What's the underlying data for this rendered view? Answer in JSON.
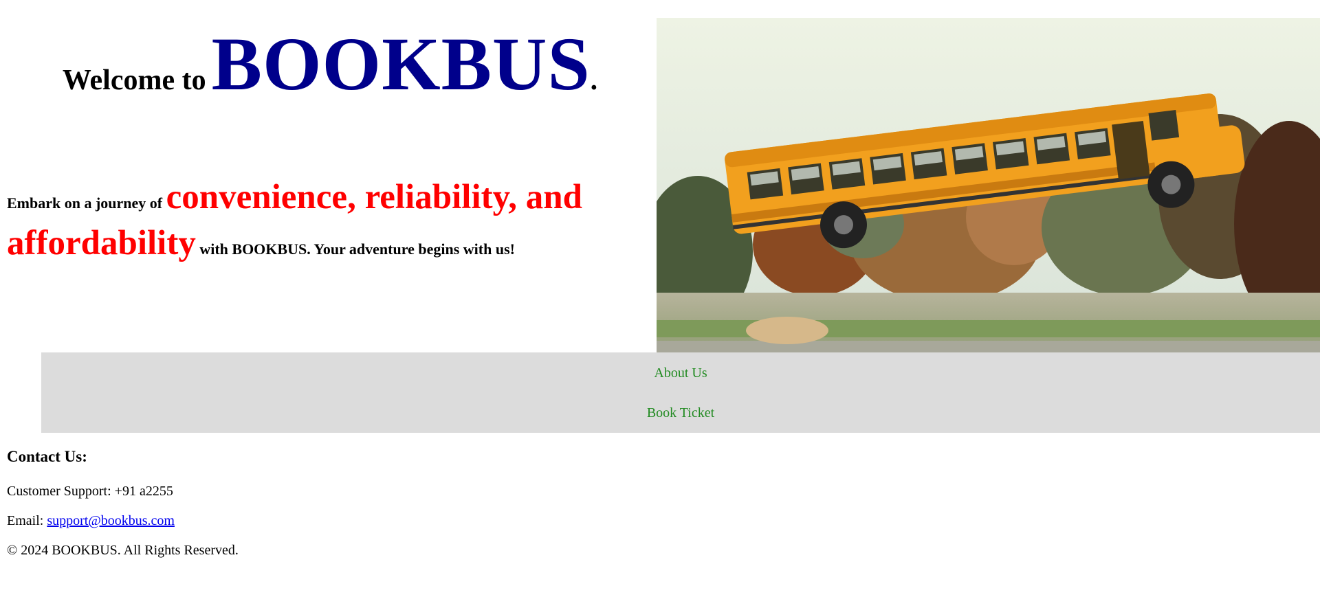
{
  "header": {
    "welcome_prefix": "Welcome to",
    "brand": "BOOKBUS",
    "brand_suffix": "."
  },
  "tagline": {
    "part1": "Embark on a journey of",
    "highlight": "convenience, reliability, and affordability",
    "part2": "with BOOKBUS. Your adventure begins with us!"
  },
  "hero_image": {
    "description_icon": "school-bus-flying-image"
  },
  "nav": {
    "about_label": "About Us",
    "book_label": "Book Ticket"
  },
  "contact": {
    "heading": "Contact Us:",
    "support": "Customer Support: +91 a2255",
    "email_prefix": "Email:",
    "email": "support@bookbus.com",
    "copyright": "© 2024 BOOKBUS. All Rights Reserved."
  },
  "colors": {
    "brand": "#00008b",
    "highlight": "#ff0000",
    "nav_bg": "#dcdcdc",
    "nav_link": "#228b22",
    "link": "#0000ee"
  }
}
